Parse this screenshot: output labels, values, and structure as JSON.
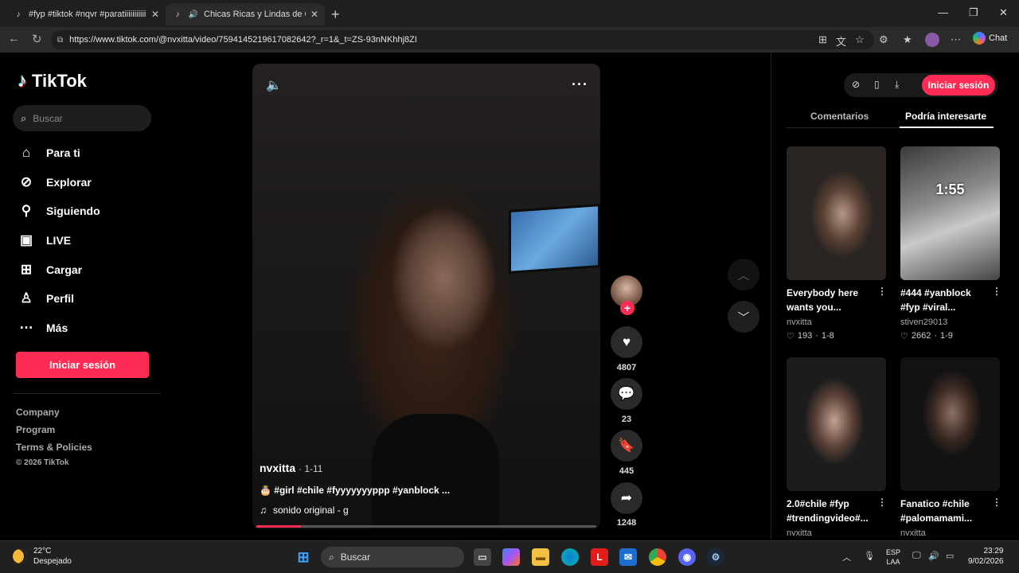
{
  "browser": {
    "tabs": [
      {
        "title": "#fyp #tiktok #nqvr #paratiiiiiiiiiiii",
        "active": false
      },
      {
        "title": "Chicas Ricas y Lindas de Chile",
        "active": true
      }
    ],
    "url": "https://www.tiktok.com/@nvxitta/video/7594145219617082642?_r=1&_t=ZS-93nNKhhj8ZI",
    "chat_label": "Chat"
  },
  "sidebar": {
    "logo": "TikTok",
    "search_placeholder": "Buscar",
    "nav": [
      {
        "label": "Para ti",
        "icon": "home-icon"
      },
      {
        "label": "Explorar",
        "icon": "compass-icon"
      },
      {
        "label": "Siguiendo",
        "icon": "user-follow-icon"
      },
      {
        "label": "LIVE",
        "icon": "live-tv-icon"
      },
      {
        "label": "Cargar",
        "icon": "upload-plus-icon"
      },
      {
        "label": "Perfil",
        "icon": "profile-icon"
      },
      {
        "label": "Más",
        "icon": "more-dots-icon"
      }
    ],
    "login_label": "Iniciar sesión",
    "footer": [
      "Company",
      "Program",
      "Terms & Policies"
    ],
    "copyright": "© 2026 TikTok"
  },
  "video": {
    "author": "nvxitta",
    "date": "· 1-11",
    "caption": "🎂 #girl #chile #fyyyyyyyppp #yanblock ...",
    "music": "sonido original - g",
    "progress": 0.13,
    "likes": "4807",
    "comments": "23",
    "saves": "445",
    "shares": "1248"
  },
  "right_panel": {
    "login_label": "Iniciar sesión",
    "tabs": [
      "Comentarios",
      "Podría interesarte"
    ],
    "active_tab": 1,
    "cards": [
      {
        "title": "Everybody here wants you...",
        "author": "nvxitta",
        "likes": "193",
        "date": "1-8"
      },
      {
        "title": "#444 #yanblock #fyp #viral...",
        "author": "stiven29013",
        "likes": "2662",
        "date": "1-9",
        "overlay": "1:55"
      },
      {
        "title": "2.0#chile #fyp #trendingvideo#...",
        "author": "nvxitta"
      },
      {
        "title": "Fanatico #chile #palomamami...",
        "author": "nvxitta"
      }
    ]
  },
  "taskbar": {
    "weather_temp": "22°C",
    "weather_desc": "Despejado",
    "search_label": "Buscar",
    "lang_1": "ESP",
    "lang_2": "LAA",
    "time": "23:29",
    "date": "9/02/2026"
  },
  "colors": {
    "accent": "#fe2c55",
    "background": "#000000"
  }
}
